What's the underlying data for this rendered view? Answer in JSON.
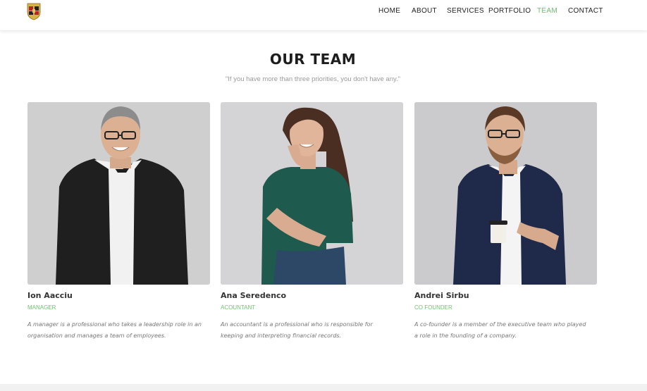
{
  "nav": {
    "items": [
      {
        "label": "HOME",
        "active": false
      },
      {
        "label": "ABOUT",
        "active": false
      },
      {
        "label": "SERVICES",
        "active": false
      },
      {
        "label": "PORTFOLIO",
        "active": false
      },
      {
        "label": "TEAM",
        "active": true
      },
      {
        "label": "CONTACT",
        "active": false
      }
    ],
    "accent": "#6bbf6b"
  },
  "logo": {
    "icon": "crest-icon"
  },
  "section": {
    "title": "OUR TEAM",
    "quote": "\"If you have more than three priorities, you don't have any.\""
  },
  "team": [
    {
      "name": "Ion Aacciu",
      "role": "MANAGER",
      "description": "A manager is a professional who takes a leadership role in an organisation and manages a team of employees."
    },
    {
      "name": "Ana Seredenco",
      "role": "ACOUNTANT",
      "description": "An accountant is a professional who is responsible for keeping and interpreting financial records."
    },
    {
      "name": "Andrei Sirbu",
      "role": "CO FOUNDER",
      "description": "A co-founder is a member of the executive team who played a role in the founding of a company."
    }
  ],
  "colors": {
    "role": "#72c372",
    "title": "#1d1d1d",
    "quote": "#9b9b9b"
  }
}
